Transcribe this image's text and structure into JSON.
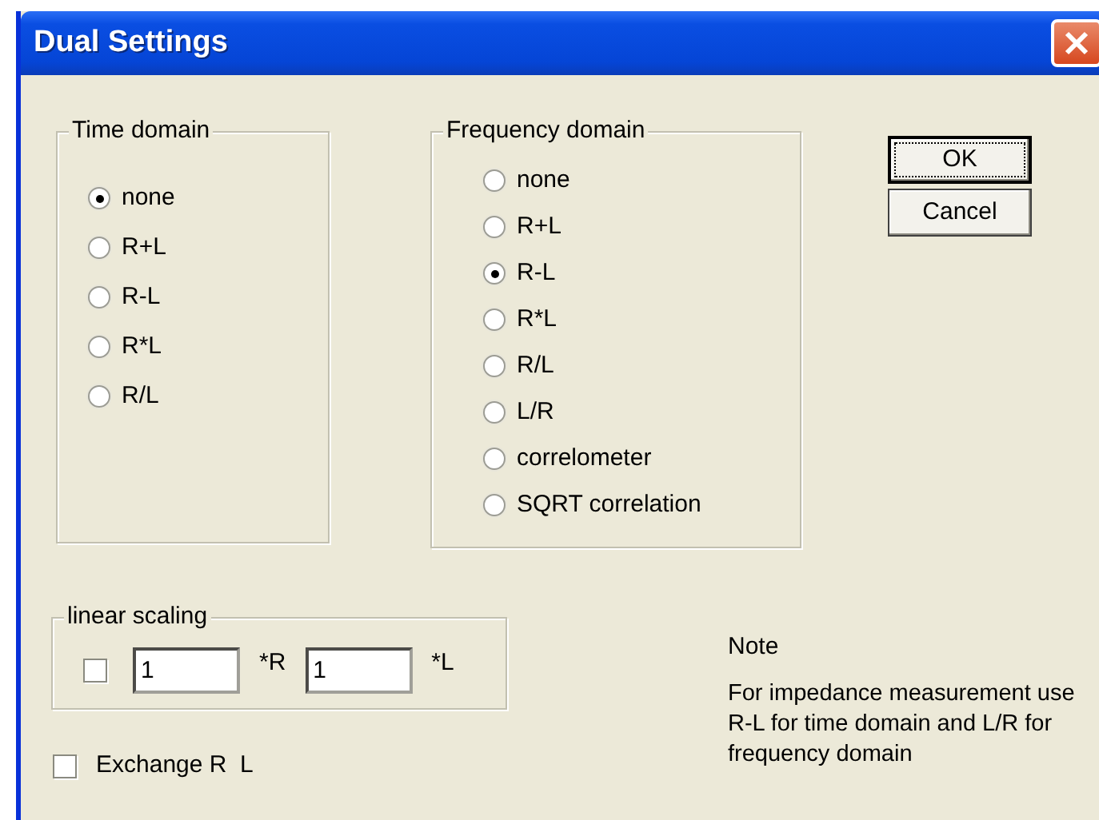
{
  "window": {
    "title": "Dual Settings"
  },
  "time_domain": {
    "label": "Time domain",
    "options": [
      {
        "label": "none",
        "selected": true
      },
      {
        "label": "R+L",
        "selected": false
      },
      {
        "label": "R-L",
        "selected": false
      },
      {
        "label": "R*L",
        "selected": false
      },
      {
        "label": "R/L",
        "selected": false
      }
    ]
  },
  "frequency_domain": {
    "label": "Frequency domain",
    "options": [
      {
        "label": "none",
        "selected": false
      },
      {
        "label": "R+L",
        "selected": false
      },
      {
        "label": "R-L",
        "selected": true
      },
      {
        "label": "R*L",
        "selected": false
      },
      {
        "label": "R/L",
        "selected": false
      },
      {
        "label": "L/R",
        "selected": false
      },
      {
        "label": "correlometer",
        "selected": false
      },
      {
        "label": "SQRT correlation",
        "selected": false
      }
    ]
  },
  "buttons": [
    {
      "label": "OK",
      "default": true
    },
    {
      "label": "Cancel",
      "default": false
    }
  ],
  "linear_scaling": {
    "label": "linear scaling",
    "checked": false,
    "r_value": "1",
    "r_label": "*R",
    "l_value": "1",
    "l_label": "*L"
  },
  "note": {
    "title": "Note",
    "text": "For impedance measurement use R-L for time domain and L/R for frequency domain"
  },
  "exchange": {
    "label": "Exchange R  L",
    "checked": false
  }
}
